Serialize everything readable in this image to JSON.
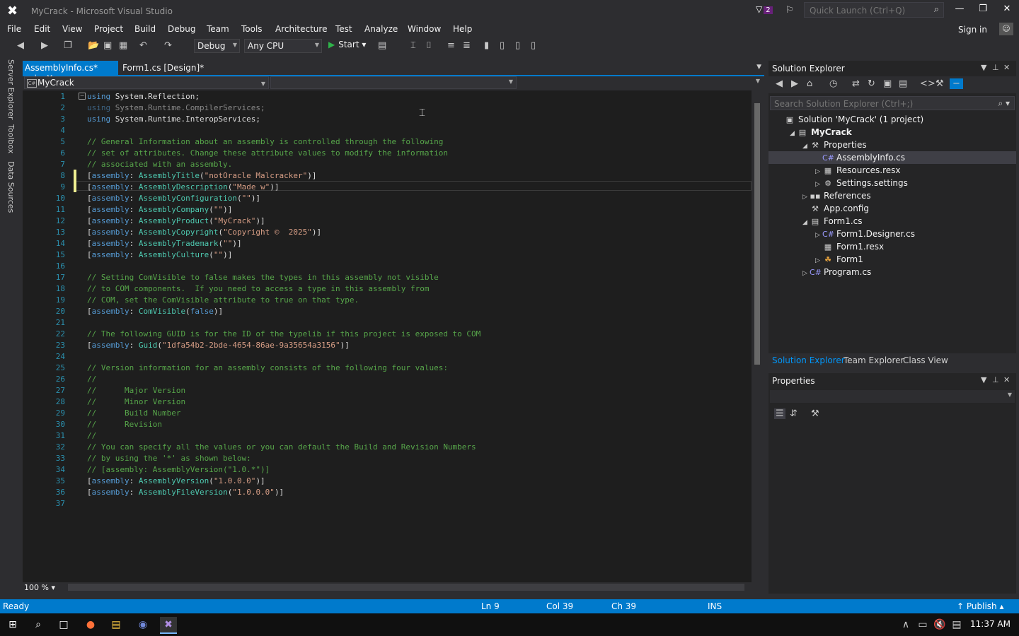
{
  "window": {
    "title": "MyCrack - Microsoft Visual Studio",
    "notification_count": "2",
    "quick_launch_placeholder": "Quick Launch (Ctrl+Q)",
    "sign_in": "Sign in"
  },
  "menu": [
    "File",
    "Edit",
    "View",
    "Project",
    "Build",
    "Debug",
    "Team",
    "Tools",
    "Architecture",
    "Test",
    "Analyze",
    "Window",
    "Help"
  ],
  "toolbar": {
    "configuration": "Debug",
    "platform": "Any CPU",
    "start_label": "Start"
  },
  "side_rail": [
    "Server Explorer",
    "Toolbox",
    "Data Sources"
  ],
  "editor": {
    "tabs": [
      {
        "label": "AssemblyInfo.cs*",
        "pin": "⊥",
        "close": "✕"
      },
      {
        "label": "Form1.cs [Design]*"
      }
    ],
    "nav_project": "MyCrack",
    "zoom": "100 %",
    "lines": [
      {
        "n": "1",
        "t": "using System.Reflection;",
        "k": "using"
      },
      {
        "n": "2",
        "t": "using System.Runtime.CompilerServices;",
        "k": "using",
        "dim": true
      },
      {
        "n": "3",
        "t": "using System.Runtime.InteropServices;",
        "k": "using"
      },
      {
        "n": "4",
        "t": ""
      },
      {
        "n": "5",
        "t": "// General Information about an assembly is controlled through the following",
        "k": "comment"
      },
      {
        "n": "6",
        "t": "// set of attributes. Change these attribute values to modify the information",
        "k": "comment"
      },
      {
        "n": "7",
        "t": "// associated with an assembly.",
        "k": "comment"
      },
      {
        "n": "8",
        "t": "[assembly: AssemblyTitle(\"notOracle Malcracker\")]",
        "k": "attr",
        "a": "AssemblyTitle",
        "s": "\"notOracle Malcracker\""
      },
      {
        "n": "9",
        "t": "[assembly: AssemblyDescription(\"Made w\")]",
        "k": "attr",
        "a": "AssemblyDescription",
        "s": "\"Made w\""
      },
      {
        "n": "10",
        "t": "[assembly: AssemblyConfiguration(\"\")]",
        "k": "attr",
        "a": "AssemblyConfiguration",
        "s": "\"\""
      },
      {
        "n": "11",
        "t": "[assembly: AssemblyCompany(\"\")]",
        "k": "attr",
        "a": "AssemblyCompany",
        "s": "\"\""
      },
      {
        "n": "12",
        "t": "[assembly: AssemblyProduct(\"MyCrack\")]",
        "k": "attr",
        "a": "AssemblyProduct",
        "s": "\"MyCrack\""
      },
      {
        "n": "13",
        "t": "[assembly: AssemblyCopyright(\"Copyright ©  2025\")]",
        "k": "attr",
        "a": "AssemblyCopyright",
        "s": "\"Copyright ©  2025\""
      },
      {
        "n": "14",
        "t": "[assembly: AssemblyTrademark(\"\")]",
        "k": "attr",
        "a": "AssemblyTrademark",
        "s": "\"\""
      },
      {
        "n": "15",
        "t": "[assembly: AssemblyCulture(\"\")]",
        "k": "attr",
        "a": "AssemblyCulture",
        "s": "\"\""
      },
      {
        "n": "16",
        "t": ""
      },
      {
        "n": "17",
        "t": "// Setting ComVisible to false makes the types in this assembly not visible",
        "k": "comment"
      },
      {
        "n": "18",
        "t": "// to COM components.  If you need to access a type in this assembly from",
        "k": "comment"
      },
      {
        "n": "19",
        "t": "// COM, set the ComVisible attribute to true on that type.",
        "k": "comment"
      },
      {
        "n": "20",
        "t": "[assembly: ComVisible(false)]",
        "k": "attrkw",
        "a": "ComVisible",
        "s": "false"
      },
      {
        "n": "21",
        "t": ""
      },
      {
        "n": "22",
        "t": "// The following GUID is for the ID of the typelib if this project is exposed to COM",
        "k": "comment"
      },
      {
        "n": "23",
        "t": "[assembly: Guid(\"1dfa54b2-2bde-4654-86ae-9a35654a3156\")]",
        "k": "attr",
        "a": "Guid",
        "s": "\"1dfa54b2-2bde-4654-86ae-9a35654a3156\""
      },
      {
        "n": "24",
        "t": ""
      },
      {
        "n": "25",
        "t": "// Version information for an assembly consists of the following four values:",
        "k": "comment"
      },
      {
        "n": "26",
        "t": "//",
        "k": "comment"
      },
      {
        "n": "27",
        "t": "//      Major Version",
        "k": "comment"
      },
      {
        "n": "28",
        "t": "//      Minor Version",
        "k": "comment"
      },
      {
        "n": "29",
        "t": "//      Build Number",
        "k": "comment"
      },
      {
        "n": "30",
        "t": "//      Revision",
        "k": "comment"
      },
      {
        "n": "31",
        "t": "//",
        "k": "comment"
      },
      {
        "n": "32",
        "t": "// You can specify all the values or you can default the Build and Revision Numbers",
        "k": "comment"
      },
      {
        "n": "33",
        "t": "// by using the '*' as shown below:",
        "k": "comment"
      },
      {
        "n": "34",
        "t": "// [assembly: AssemblyVersion(\"1.0.*\")]",
        "k": "comment"
      },
      {
        "n": "35",
        "t": "[assembly: AssemblyVersion(\"1.0.0.0\")]",
        "k": "attr",
        "a": "AssemblyVersion",
        "s": "\"1.0.0.0\""
      },
      {
        "n": "36",
        "t": "[assembly: AssemblyFileVersion(\"1.0.0.0\")]",
        "k": "attr",
        "a": "AssemblyFileVersion",
        "s": "\"1.0.0.0\""
      },
      {
        "n": "37",
        "t": ""
      }
    ]
  },
  "solution_explorer": {
    "title": "Solution Explorer",
    "search_placeholder": "Search Solution Explorer (Ctrl+;)",
    "tree": [
      {
        "label": "Solution 'MyCrack' (1 project)",
        "icon": "solution-icon",
        "glyph": "▣",
        "exp": "",
        "depth": 0
      },
      {
        "label": "MyCrack",
        "icon": "csharp-project-icon",
        "glyph": "▤",
        "exp": "◢",
        "depth": 1,
        "bold": true
      },
      {
        "label": "Properties",
        "icon": "wrench-icon",
        "glyph": "⚒",
        "exp": "◢",
        "depth": 2
      },
      {
        "label": "AssemblyInfo.cs",
        "icon": "csharp-file-icon",
        "glyph": "C#",
        "exp": "",
        "depth": 3,
        "selected": true
      },
      {
        "label": "Resources.resx",
        "icon": "resx-file-icon",
        "glyph": "▦",
        "exp": "▷",
        "depth": 3
      },
      {
        "label": "Settings.settings",
        "icon": "settings-gear-icon",
        "glyph": "⚙",
        "exp": "▷",
        "depth": 3
      },
      {
        "label": "References",
        "icon": "references-icon",
        "glyph": "▪▪",
        "exp": "▷",
        "depth": 2
      },
      {
        "label": "App.config",
        "icon": "config-file-icon",
        "glyph": "⚒",
        "exp": "",
        "depth": 2
      },
      {
        "label": "Form1.cs",
        "icon": "form-file-icon",
        "glyph": "▤",
        "exp": "◢",
        "depth": 2
      },
      {
        "label": "Form1.Designer.cs",
        "icon": "csharp-file-icon",
        "glyph": "C#",
        "exp": "▷",
        "depth": 3
      },
      {
        "label": "Form1.resx",
        "icon": "resx-file-icon",
        "glyph": "▦",
        "exp": "",
        "depth": 3
      },
      {
        "label": "Form1",
        "icon": "class-icon",
        "glyph": "☘",
        "exp": "▷",
        "depth": 3
      },
      {
        "label": "Program.cs",
        "icon": "csharp-file-icon",
        "glyph": "C#",
        "exp": "▷",
        "depth": 2
      }
    ],
    "bottom_tabs": [
      "Solution Explorer",
      "Team Explorer",
      "Class View"
    ]
  },
  "properties": {
    "title": "Properties"
  },
  "status": {
    "ready": "Ready",
    "ln": "Ln 9",
    "col": "Col 39",
    "ch": "Ch 39",
    "ins": "INS",
    "publish": "Publish"
  },
  "taskbar": {
    "time": "11:37 AM"
  },
  "colors": {
    "accent": "#007acc",
    "keyword": "#569cd6",
    "comment": "#57a64a",
    "string": "#d69d85",
    "type": "#4ec9b0"
  }
}
